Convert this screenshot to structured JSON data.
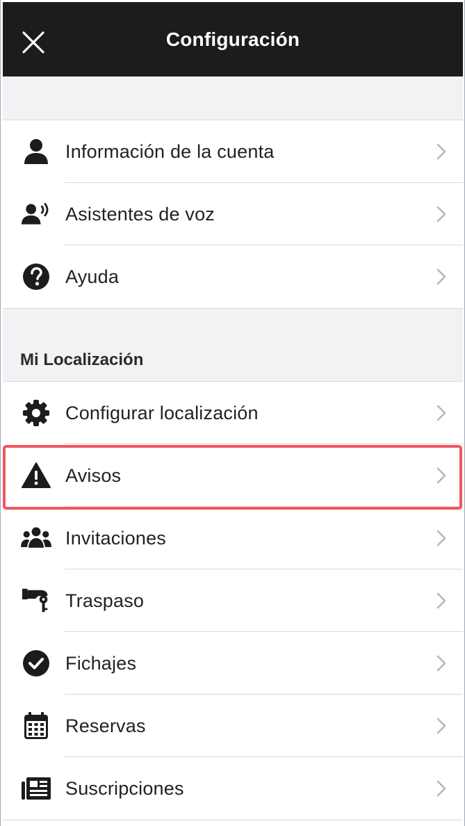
{
  "header": {
    "title": "Configuración"
  },
  "account_group": {
    "items": [
      {
        "label": "Información de la cuenta",
        "icon": "person-icon"
      },
      {
        "label": "Asistentes de voz",
        "icon": "voice-assistant-icon"
      },
      {
        "label": "Ayuda",
        "icon": "help-icon"
      }
    ]
  },
  "location_section": {
    "title": "Mi Localización",
    "items": [
      {
        "label": "Configurar localización",
        "icon": "gear-icon"
      },
      {
        "label": "Avisos",
        "icon": "warning-icon",
        "highlighted": true
      },
      {
        "label": "Invitaciones",
        "icon": "group-icon"
      },
      {
        "label": "Traspaso",
        "icon": "key-handover-icon"
      },
      {
        "label": "Fichajes",
        "icon": "check-circle-icon"
      },
      {
        "label": "Reservas",
        "icon": "calendar-icon"
      },
      {
        "label": "Suscripciones",
        "icon": "newspaper-icon"
      }
    ]
  },
  "colors": {
    "navbar": "#1c1c1c",
    "section_background": "#f2f2f4",
    "highlight": "#f2565f",
    "chevron": "#b8b8bc"
  }
}
